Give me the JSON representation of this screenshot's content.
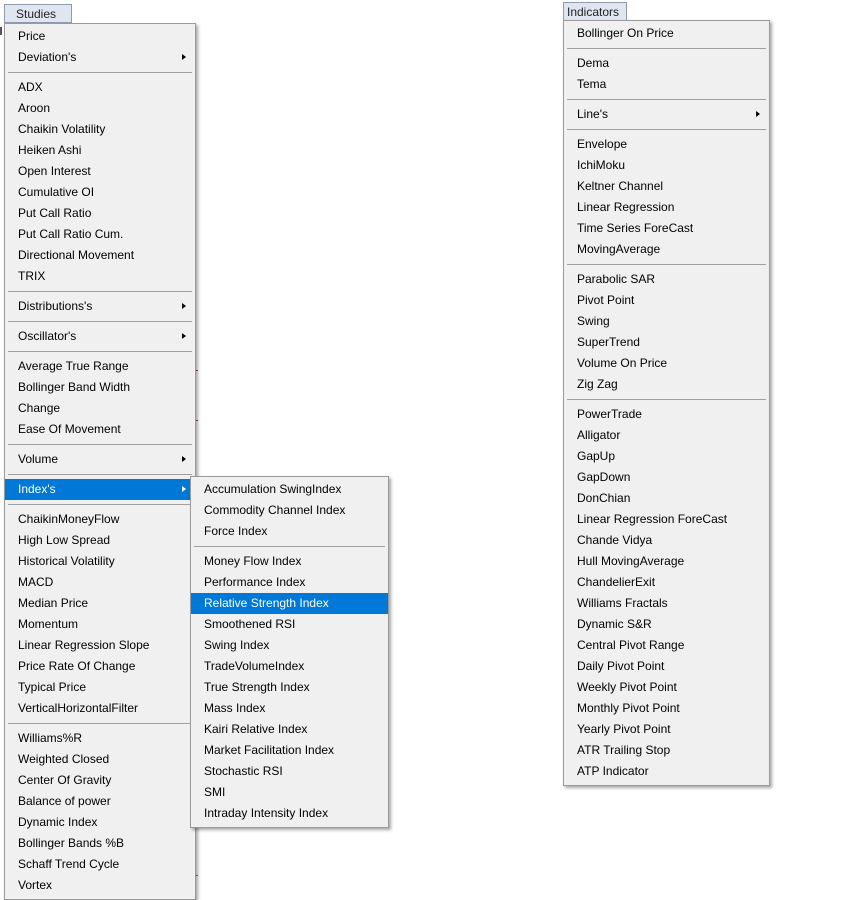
{
  "studies": {
    "button_label": "Studies",
    "groups": [
      [
        {
          "label": "Price"
        },
        {
          "label": "Deviation's",
          "submenu": true
        }
      ],
      [
        {
          "label": "ADX"
        },
        {
          "label": "Aroon"
        },
        {
          "label": "Chaikin Volatility"
        },
        {
          "label": "Heiken Ashi"
        },
        {
          "label": "Open Interest"
        },
        {
          "label": "Cumulative OI"
        },
        {
          "label": "Put Call Ratio"
        },
        {
          "label": "Put Call Ratio Cum."
        },
        {
          "label": "Directional Movement"
        },
        {
          "label": "TRIX"
        }
      ],
      [
        {
          "label": "Distributions's",
          "submenu": true
        }
      ],
      [
        {
          "label": "Oscillator's",
          "submenu": true
        }
      ],
      [
        {
          "label": "Average True Range"
        },
        {
          "label": "Bollinger Band Width"
        },
        {
          "label": "Change"
        },
        {
          "label": "Ease Of Movement"
        }
      ],
      [
        {
          "label": "Volume",
          "submenu": true
        }
      ],
      [
        {
          "label": "Index's",
          "submenu": true,
          "highlighted": true
        }
      ],
      [
        {
          "label": "ChaikinMoneyFlow"
        },
        {
          "label": "High Low Spread"
        },
        {
          "label": "Historical Volatility"
        },
        {
          "label": "MACD"
        },
        {
          "label": "Median Price"
        },
        {
          "label": "Momentum"
        },
        {
          "label": "Linear Regression Slope"
        },
        {
          "label": "Price Rate Of Change"
        },
        {
          "label": "Typical Price"
        },
        {
          "label": "VerticalHorizontalFilter"
        }
      ],
      [
        {
          "label": "Williams%R"
        },
        {
          "label": "Weighted Closed"
        },
        {
          "label": "Center Of Gravity"
        },
        {
          "label": "Balance of power"
        },
        {
          "label": "Dynamic Index"
        },
        {
          "label": "Bollinger Bands %B"
        },
        {
          "label": "Schaff Trend Cycle"
        },
        {
          "label": "Vortex"
        }
      ]
    ]
  },
  "index_submenu": {
    "groups": [
      [
        {
          "label": "Accumulation SwingIndex"
        },
        {
          "label": "Commodity Channel Index"
        },
        {
          "label": "Force Index"
        }
      ],
      [
        {
          "label": "Money Flow Index"
        },
        {
          "label": "Performance Index"
        },
        {
          "label": "Relative Strength Index",
          "highlighted": true
        },
        {
          "label": "Smoothened RSI"
        },
        {
          "label": "Swing Index"
        },
        {
          "label": "TradeVolumeIndex"
        },
        {
          "label": "True Strength Index"
        },
        {
          "label": "Mass Index"
        },
        {
          "label": "Kairi Relative Index"
        },
        {
          "label": "Market Facilitation Index"
        },
        {
          "label": "Stochastic RSI"
        },
        {
          "label": "SMI"
        },
        {
          "label": "Intraday Intensity Index"
        }
      ]
    ]
  },
  "indicators": {
    "button_label": "Indicators",
    "groups": [
      [
        {
          "label": "Bollinger On Price"
        }
      ],
      [
        {
          "label": "Dema"
        },
        {
          "label": "Tema"
        }
      ],
      [
        {
          "label": "Line's",
          "submenu": true
        }
      ],
      [
        {
          "label": "Envelope"
        },
        {
          "label": "IchiMoku"
        },
        {
          "label": "Keltner Channel"
        },
        {
          "label": "Linear Regression"
        },
        {
          "label": "Time Series ForeCast"
        },
        {
          "label": "MovingAverage"
        }
      ],
      [
        {
          "label": "Parabolic SAR"
        },
        {
          "label": "Pivot Point"
        },
        {
          "label": "Swing"
        },
        {
          "label": "SuperTrend"
        },
        {
          "label": "Volume On Price"
        },
        {
          "label": "Zig Zag"
        }
      ],
      [
        {
          "label": "PowerTrade"
        },
        {
          "label": "Alligator"
        },
        {
          "label": "GapUp"
        },
        {
          "label": "GapDown"
        },
        {
          "label": "DonChian"
        },
        {
          "label": "Linear Regression ForeCast"
        },
        {
          "label": "Chande Vidya"
        },
        {
          "label": "Hull MovingAverage"
        },
        {
          "label": "ChandelierExit"
        },
        {
          "label": "Williams Fractals"
        },
        {
          "label": "Dynamic S&R"
        },
        {
          "label": "Central Pivot Range"
        },
        {
          "label": "Daily Pivot Point"
        },
        {
          "label": "Weekly Pivot Point"
        },
        {
          "label": "Monthly Pivot Point"
        },
        {
          "label": "Yearly Pivot Point"
        },
        {
          "label": "ATR Trailing Stop"
        },
        {
          "label": "ATP Indicator"
        }
      ]
    ]
  },
  "colors": {
    "menu_bg": "#f0f0f0",
    "highlight": "#0078d7",
    "highlight_text": "#ffffff",
    "separator": "#a0a0a0",
    "button_bg": "#dfe6f0"
  }
}
